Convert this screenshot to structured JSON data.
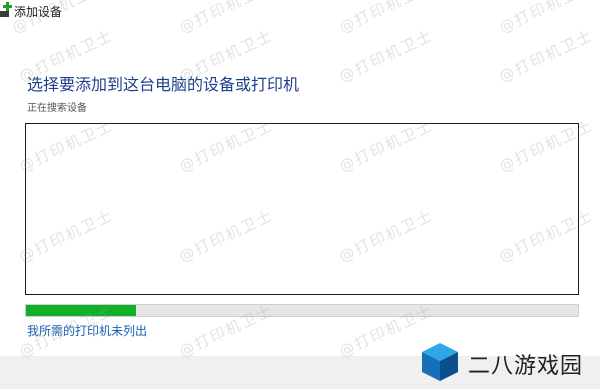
{
  "window": {
    "title": "添加设备",
    "icon": "add-device-icon"
  },
  "main": {
    "heading": "选择要添加到这台电脑的设备或打印机",
    "status": "正在搜索设备",
    "progress": 0.2,
    "not_listed_link": "我所需的打印机未列出"
  },
  "watermark": "@打印机卫士",
  "brand": {
    "text": "二八游戏园",
    "icon": "cube-logo-icon"
  },
  "colors": {
    "accent": "#1e3f8f",
    "link": "#1a5fb4",
    "progress": "#10b02a"
  }
}
